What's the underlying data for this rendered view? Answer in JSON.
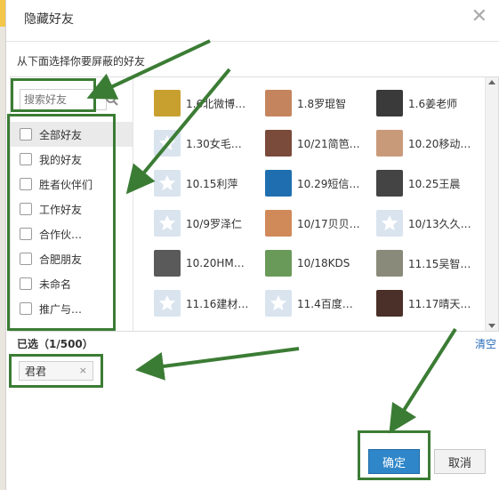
{
  "dialog": {
    "title": "隐藏好友",
    "instruction": "从下面选择你要屏蔽的好友",
    "close_glyph": "✕"
  },
  "search": {
    "placeholder": "搜索好友"
  },
  "groups": [
    {
      "label": "全部好友",
      "active": true
    },
    {
      "label": "我的好友",
      "active": false
    },
    {
      "label": "胜者伙伴们",
      "active": false
    },
    {
      "label": "工作好友",
      "active": false
    },
    {
      "label": "合作伙…",
      "active": false
    },
    {
      "label": "合肥朋友",
      "active": false
    },
    {
      "label": "未命名",
      "active": false
    },
    {
      "label": "推广与…",
      "active": false
    }
  ],
  "friends": [
    {
      "name": "1.6北微博…",
      "avatar": "#c8a030"
    },
    {
      "name": "1.8罗琨智",
      "avatar": "#c4855e"
    },
    {
      "name": "1.6姜老师",
      "avatar": "#3a3a3a"
    },
    {
      "name": "1.30女毛…",
      "avatar": "star"
    },
    {
      "name": "10/21简笆…",
      "avatar": "#7a4a3a"
    },
    {
      "name": "10.20移动…",
      "avatar": "#c99a7a"
    },
    {
      "name": "10.15利萍",
      "avatar": "star"
    },
    {
      "name": "10.29短信…",
      "avatar": "#1f6fb0"
    },
    {
      "name": "10.25王晨",
      "avatar": "#444444"
    },
    {
      "name": "10/9罗泽仁",
      "avatar": "star"
    },
    {
      "name": "10/17贝贝…",
      "avatar": "#d08a5a"
    },
    {
      "name": "10/13久久…",
      "avatar": "star"
    },
    {
      "name": "10.20HM…",
      "avatar": "#5a5a5a"
    },
    {
      "name": "10/18KDS",
      "avatar": "#6a9a5a"
    },
    {
      "name": "11.15吴智…",
      "avatar": "#8a8a7a"
    },
    {
      "name": "11.16建材…",
      "avatar": "star"
    },
    {
      "name": "11.4百度…",
      "avatar": "star"
    },
    {
      "name": "11.17晴天…",
      "avatar": "#4a3028"
    }
  ],
  "selection": {
    "label": "已选（1/500）",
    "clear_label": "清空",
    "tags": [
      {
        "name": "君君",
        "remove_glyph": "×"
      }
    ]
  },
  "buttons": {
    "ok": "确定",
    "cancel": "取消"
  },
  "colors": {
    "highlight": "#3b7c34",
    "primary_button": "#2f86c9",
    "link": "#2a6ebb"
  }
}
